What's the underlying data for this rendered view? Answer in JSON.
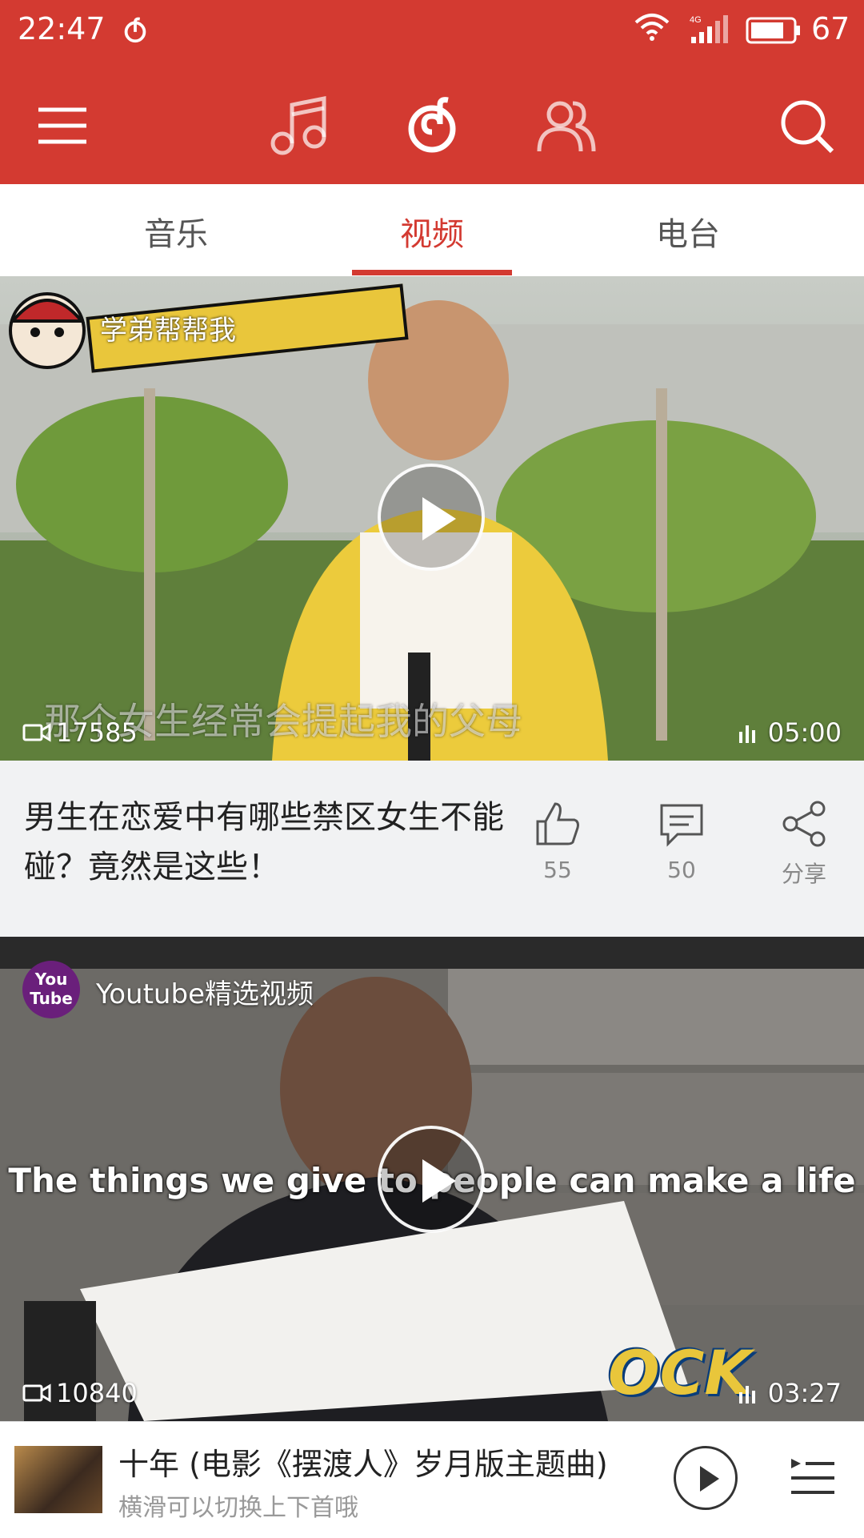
{
  "status_bar": {
    "time": "22:47",
    "network": "4G",
    "battery": "67"
  },
  "header": {
    "icons": [
      "menu-icon",
      "music-note-icon",
      "netease-logo-icon",
      "friends-icon",
      "search-icon"
    ]
  },
  "tabs": [
    {
      "label": "音乐",
      "active": false
    },
    {
      "label": "视频",
      "active": true
    },
    {
      "label": "电台",
      "active": false
    }
  ],
  "videos": [
    {
      "channel": "学弟帮帮我",
      "banner_text": "男生在恋爱中有哪些禁区",
      "subtitle": "那个女生经常会提起我的父母",
      "views": "17585",
      "duration": "05:00",
      "title": "男生在恋爱中有哪些禁区女生不能碰？竟然是这些！",
      "likes": "55",
      "comments": "50",
      "share_label": "分享"
    },
    {
      "channel": "Youtube精选视频",
      "channel_avatar_text": "You Tube",
      "subtitle": "The things we give to people can make a life",
      "watermark": "OCK",
      "views": "10840",
      "duration": "03:27"
    }
  ],
  "player": {
    "song": "十年 (电影《摆渡人》岁月版主题曲)",
    "hint": "横滑可以切换上下首哦"
  },
  "colors": {
    "brand_red": "#d33a31",
    "background": "#f1f2f3"
  }
}
